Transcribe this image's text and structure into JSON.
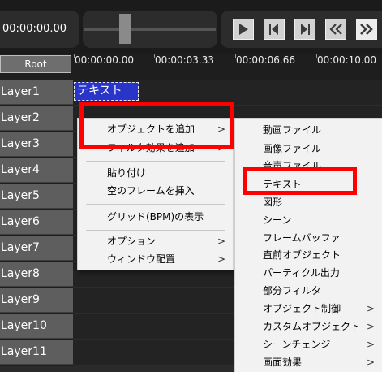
{
  "timecode": "00:00:00.00",
  "transport": {
    "play_icon": "play-icon",
    "prev_frame_icon": "step-back-icon",
    "next_frame_icon": "step-forward-icon",
    "rewind_icon": "rewind-icon",
    "fast_forward_icon": "fast-forward-icon"
  },
  "timeline": {
    "root_label": "Root",
    "ruler_labels": [
      "00:00:00.00",
      "00:00:03.33",
      "00:00:06.66",
      "00:00:10.00"
    ],
    "layers": [
      "Layer1",
      "Layer2",
      "Layer3",
      "Layer4",
      "Layer5",
      "Layer6",
      "Layer7",
      "Layer8",
      "Layer9",
      "Layer10",
      "Layer11"
    ],
    "object_label": "テキスト"
  },
  "context_menu": {
    "items": [
      {
        "label": "オブジェクトを追加",
        "submenu": true
      },
      {
        "label": "フィルタ効果を追加",
        "submenu": true
      },
      {
        "label": "貼り付け",
        "submenu": false
      },
      {
        "label": "空のフレームを挿入",
        "submenu": false
      },
      {
        "label": "グリッド(BPM)の表示",
        "submenu": false
      },
      {
        "label": "オプション",
        "submenu": true
      },
      {
        "label": "ウィンドウ配置",
        "submenu": true
      }
    ],
    "submenu_arrow": ">"
  },
  "submenu": {
    "items": [
      {
        "label": "動画ファイル",
        "submenu": false
      },
      {
        "label": "画像ファイル",
        "submenu": false
      },
      {
        "label": "音声ファイル",
        "submenu": false
      },
      {
        "label": "テキスト",
        "submenu": false
      },
      {
        "label": "図形",
        "submenu": false
      },
      {
        "label": "シーン",
        "submenu": false
      },
      {
        "label": "フレームバッファ",
        "submenu": false
      },
      {
        "label": "直前オブジェクト",
        "submenu": false
      },
      {
        "label": "パーティクル出力",
        "submenu": false
      },
      {
        "label": "部分フィルタ",
        "submenu": false
      },
      {
        "label": "オブジェクト制御",
        "submenu": true
      },
      {
        "label": "カスタムオブジェクト",
        "submenu": true
      },
      {
        "label": "シーンチェンジ",
        "submenu": true
      },
      {
        "label": "画面効果",
        "submenu": true
      }
    ]
  },
  "highlight_color": "#ff0000"
}
